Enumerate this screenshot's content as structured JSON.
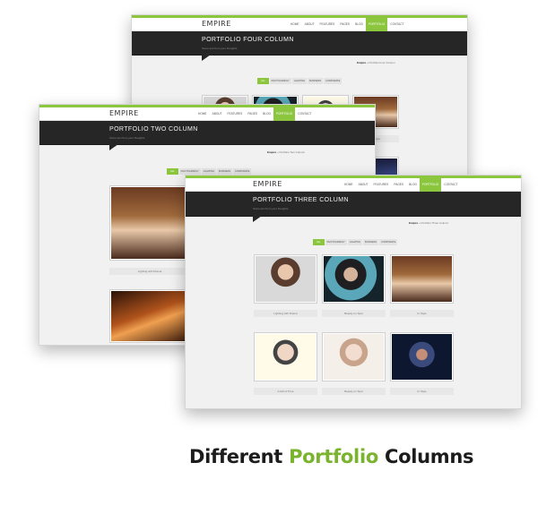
{
  "brand": "EMPIRE",
  "accent_color": "#8cc63f",
  "nav": [
    "HOME",
    "ABOUT",
    "FEATURES",
    "PAGES",
    "BLOG",
    "PORTFOLIO",
    "CONTACT"
  ],
  "active_nav": "PORTFOLIO",
  "tagline": "Some text from your thoughts",
  "filters": [
    "ALL",
    "PHOTOGRAPHY",
    "LIGHTING",
    "BUSINESS",
    "CORPORATE"
  ],
  "screens": {
    "four": {
      "title": "PORTFOLIO FOUR COLUMN",
      "crumb_home": "Empire",
      "crumb_page": "Portfolio Four Column",
      "captions": [
        "In Style"
      ]
    },
    "two": {
      "title": "PORTFOLIO TWO COLUMN",
      "crumb_home": "Empire",
      "crumb_page": "Portfolio Two Column",
      "captions": [
        "Lighting with Drama"
      ]
    },
    "three": {
      "title": "PORTFOLIO THREE COLUMN",
      "crumb_home": "Empire",
      "crumb_page": "Portfolio Three Column",
      "captions": [
        "Lighting with Drama",
        "Beauty on Spot",
        "In Style",
        "A Gift of Time",
        "Beauty on Spot",
        "In Style"
      ]
    }
  },
  "headline": {
    "before": "Different",
    "accent": "Portfolio",
    "after": "Columns"
  }
}
